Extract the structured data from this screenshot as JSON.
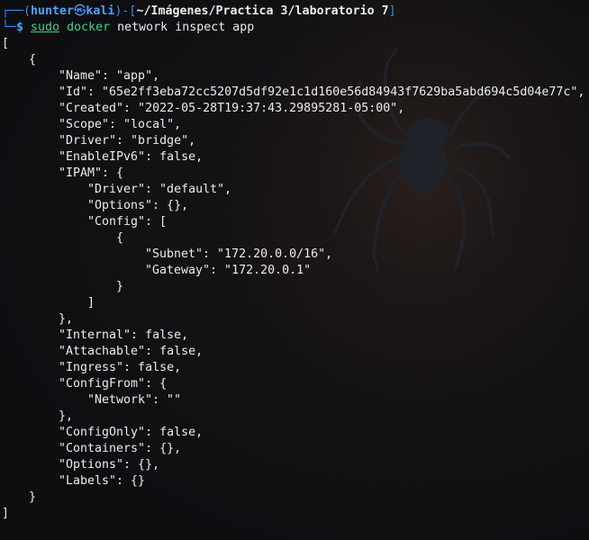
{
  "prompt": {
    "corner_top": "┌──(",
    "user": "hunter",
    "at_symbol": "㉿",
    "host": "kali",
    "close_bracket": ")-[",
    "path": "~/Imágenes/Practica 3/laboratorio 7",
    "path_close": "]",
    "corner_bottom": "└─",
    "dollar": "$",
    "sudo": "sudo",
    "program": "docker",
    "args": " network inspect app"
  },
  "output": {
    "l01": "[",
    "l02": "{",
    "l03": "\"Name\": \"app\",",
    "l04": "\"Id\": \"65e2ff3eba72cc5207d5df92e1c1d160e56d84943f7629ba5abd694c5d04e77c\",",
    "l05": "\"Created\": \"2022-05-28T19:37:43.29895281-05:00\",",
    "l06": "\"Scope\": \"local\",",
    "l07": "\"Driver\": \"bridge\",",
    "l08": "\"EnableIPv6\": false,",
    "l09": "\"IPAM\": {",
    "l10": "\"Driver\": \"default\",",
    "l11": "\"Options\": {},",
    "l12": "\"Config\": [",
    "l13": "{",
    "l14": "\"Subnet\": \"172.20.0.0/16\",",
    "l15": "\"Gateway\": \"172.20.0.1\"",
    "l16": "}",
    "l17": "]",
    "l18": "},",
    "l19": "\"Internal\": false,",
    "l20": "\"Attachable\": false,",
    "l21": "\"Ingress\": false,",
    "l22": "\"ConfigFrom\": {",
    "l23": "\"Network\": \"\"",
    "l24": "},",
    "l25": "\"ConfigOnly\": false,",
    "l26": "\"Containers\": {},",
    "l27": "\"Options\": {},",
    "l28": "\"Labels\": {}",
    "l29": "}",
    "l30": "]"
  },
  "colors": {
    "prompt_blue": "#4ea0ff",
    "command_green": "#3fd18a",
    "text": "#ecebee",
    "background": "#0f0f12"
  },
  "icons": {
    "background": "spider-wallpaper-icon"
  }
}
